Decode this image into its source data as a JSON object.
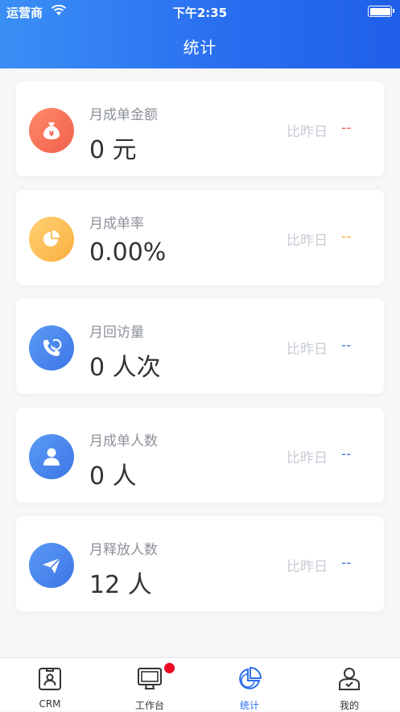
{
  "status_bar": {
    "carrier": "运营商",
    "time": "下午2:35"
  },
  "nav": {
    "title": "统计"
  },
  "colors": {
    "accent": "#2a6ff0",
    "red": "#f0604c",
    "yellow": "#f9ae3f",
    "blue": "#3c76e6"
  },
  "cards": [
    {
      "label": "月成单金额",
      "value": "0 元",
      "compare_label": "比昨日",
      "compare_value": "--",
      "icon": "money-bag-icon"
    },
    {
      "label": "月成单率",
      "value": "0.00%",
      "compare_label": "比昨日",
      "compare_value": "--",
      "icon": "pie-chart-icon"
    },
    {
      "label": "月回访量",
      "value": "0 人次",
      "compare_label": "比昨日",
      "compare_value": "--",
      "icon": "phone-callback-icon"
    },
    {
      "label": "月成单人数",
      "value": "0 人",
      "compare_label": "比昨日",
      "compare_value": "--",
      "icon": "person-icon"
    },
    {
      "label": "月释放人数",
      "value": "12 人",
      "compare_label": "比昨日",
      "compare_value": "--",
      "icon": "paper-plane-icon"
    }
  ],
  "tabbar": {
    "tabs": [
      {
        "label": "CRM",
        "icon": "crm-card-icon"
      },
      {
        "label": "工作台",
        "icon": "monitor-icon"
      },
      {
        "label": "统计",
        "icon": "statistics-icon",
        "active": true
      },
      {
        "label": "我的",
        "icon": "profile-icon"
      }
    ]
  }
}
